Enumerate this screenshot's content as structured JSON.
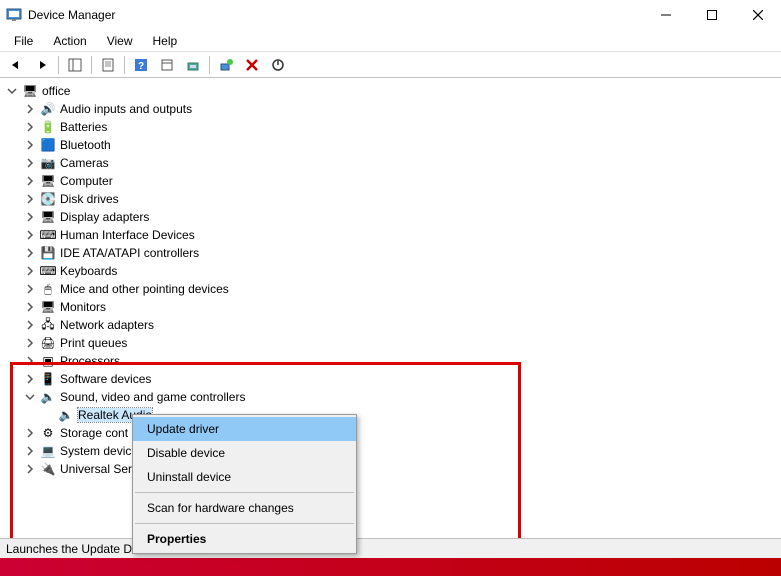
{
  "window": {
    "title": "Device Manager"
  },
  "menu": {
    "file": "File",
    "action": "Action",
    "view": "View",
    "help": "Help"
  },
  "tree": {
    "root": "office",
    "categories": [
      {
        "label": "Audio inputs and outputs",
        "icon": "speaker"
      },
      {
        "label": "Batteries",
        "icon": "battery"
      },
      {
        "label": "Bluetooth",
        "icon": "bluetooth"
      },
      {
        "label": "Cameras",
        "icon": "camera"
      },
      {
        "label": "Computer",
        "icon": "monitor"
      },
      {
        "label": "Disk drives",
        "icon": "disk"
      },
      {
        "label": "Display adapters",
        "icon": "monitor"
      },
      {
        "label": "Human Interface Devices",
        "icon": "hid"
      },
      {
        "label": "IDE ATA/ATAPI controllers",
        "icon": "ide"
      },
      {
        "label": "Keyboards",
        "icon": "keyboard"
      },
      {
        "label": "Mice and other pointing devices",
        "icon": "mouse"
      },
      {
        "label": "Monitors",
        "icon": "monitor"
      },
      {
        "label": "Network adapters",
        "icon": "network"
      },
      {
        "label": "Print queues",
        "icon": "printer"
      },
      {
        "label": "Processors",
        "icon": "cpu"
      },
      {
        "label": "Software devices",
        "icon": "software"
      },
      {
        "label": "Sound, video and game controllers",
        "icon": "sound",
        "expanded": true,
        "children": [
          {
            "label": "Realtek Audio",
            "icon": "sound",
            "selected": true
          }
        ]
      },
      {
        "label": "Storage cont",
        "icon": "storage"
      },
      {
        "label": "System devic",
        "icon": "system"
      },
      {
        "label": "Universal Ser",
        "icon": "usb"
      }
    ]
  },
  "context_menu": {
    "items": [
      {
        "label": "Update driver",
        "highlighted": true
      },
      {
        "label": "Disable device"
      },
      {
        "label": "Uninstall device"
      },
      {
        "sep": true
      },
      {
        "label": "Scan for hardware changes"
      },
      {
        "sep": true
      },
      {
        "label": "Properties",
        "bold": true
      }
    ]
  },
  "statusbar": {
    "text": "Launches the Update Driver Wizard for the selected device."
  },
  "icons": {
    "app": "🖥",
    "speaker": "🔊",
    "battery": "🔋",
    "bluetooth": "🟦",
    "camera": "📷",
    "monitor": "🖥",
    "disk": "💽",
    "hid": "⌨",
    "ide": "💾",
    "keyboard": "⌨",
    "mouse": "🖱",
    "network": "🖧",
    "printer": "🖨",
    "cpu": "▣",
    "software": "📱",
    "sound": "🔈",
    "storage": "⚙",
    "system": "💻",
    "usb": "🔌",
    "pc": "🖥"
  }
}
